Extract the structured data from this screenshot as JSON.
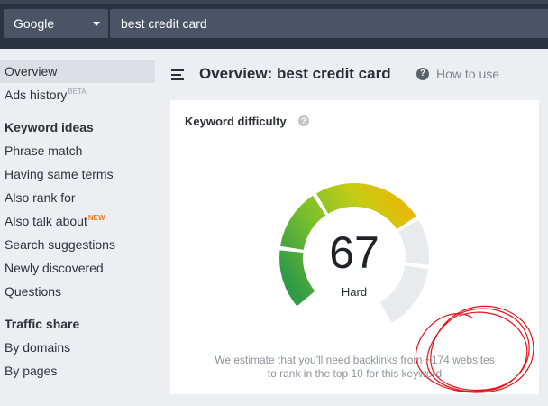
{
  "search": {
    "engine": "Google",
    "query": "best credit card"
  },
  "sidebar": {
    "overview": "Overview",
    "ads_history": "Ads history",
    "ads_history_badge": "BETA",
    "keyword_ideas_heading": "Keyword ideas",
    "keyword_ideas": [
      "Phrase match",
      "Having same terms",
      "Also rank for",
      "Also talk about",
      "Search suggestions",
      "Newly discovered",
      "Questions"
    ],
    "also_talk_about_badge": "NEW",
    "traffic_share_heading": "Traffic share",
    "traffic_share": [
      "By domains",
      "By pages"
    ]
  },
  "header": {
    "title": "Overview: best credit card",
    "help_link": "How to use",
    "help_icon": "?"
  },
  "card": {
    "title": "Keyword difficulty",
    "info_icon": "?",
    "score": "67",
    "score_value": 67,
    "score_max": 100,
    "label": "Hard",
    "estimate_line1": "We estimate that you'll need backlinks from ~174 websites",
    "estimate_line2": "to rank in the top 10 for this keyword"
  },
  "colors": {
    "topbar": "#2b3242",
    "input_bg": "#4b5366",
    "gauge_track": "#e8eaed",
    "new_badge": "#f07a16",
    "scribble": "#e2141a"
  },
  "icons": {
    "menu": "hamburger-menu-icon",
    "help": "question-circle-icon",
    "info": "info-icon",
    "engine": "chevron-down-icon"
  }
}
